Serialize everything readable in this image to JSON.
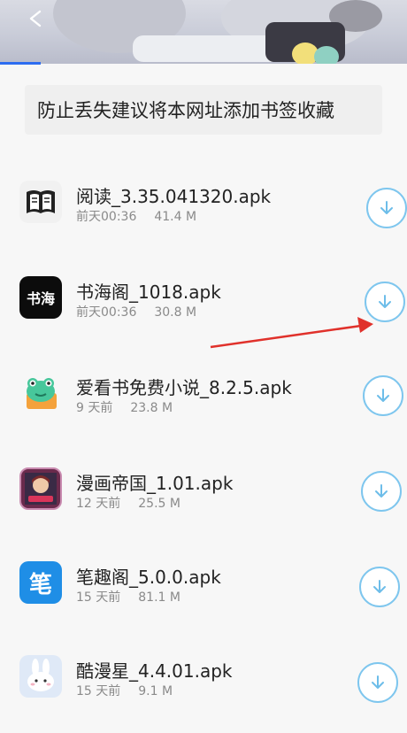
{
  "notice": {
    "text": "防止丢失建议将本网址添加书签收藏"
  },
  "apps": [
    {
      "name": "阅读_3.35.041320.apk",
      "date": "前天00:36",
      "size": "41.4 M",
      "icon": "book-icon",
      "icon_label": ""
    },
    {
      "name": "书海阁_1018.apk",
      "date": "前天00:36",
      "size": "30.8 M",
      "icon": "shuhai-logo-icon",
      "icon_label": "书海"
    },
    {
      "name": "爱看书免费小说_8.2.5.apk",
      "date": "9 天前",
      "size": "23.8 M",
      "icon": "frog-book-icon",
      "icon_label": ""
    },
    {
      "name": "漫画帝国_1.01.apk",
      "date": "12 天前",
      "size": "25.5 M",
      "icon": "manga-icon",
      "icon_label": ""
    },
    {
      "name": "笔趣阁_5.0.0.apk",
      "date": "15 天前",
      "size": "81.1 M",
      "icon": "biquge-logo-icon",
      "icon_label": "笔"
    },
    {
      "name": "酷漫星_4.4.01.apk",
      "date": "15 天前",
      "size": "9.1 M",
      "icon": "bunny-icon",
      "icon_label": ""
    }
  ],
  "colors": {
    "accent": "#2d6df0",
    "download_ring": "#7ec6ee",
    "annotation_arrow": "#e0312b"
  }
}
